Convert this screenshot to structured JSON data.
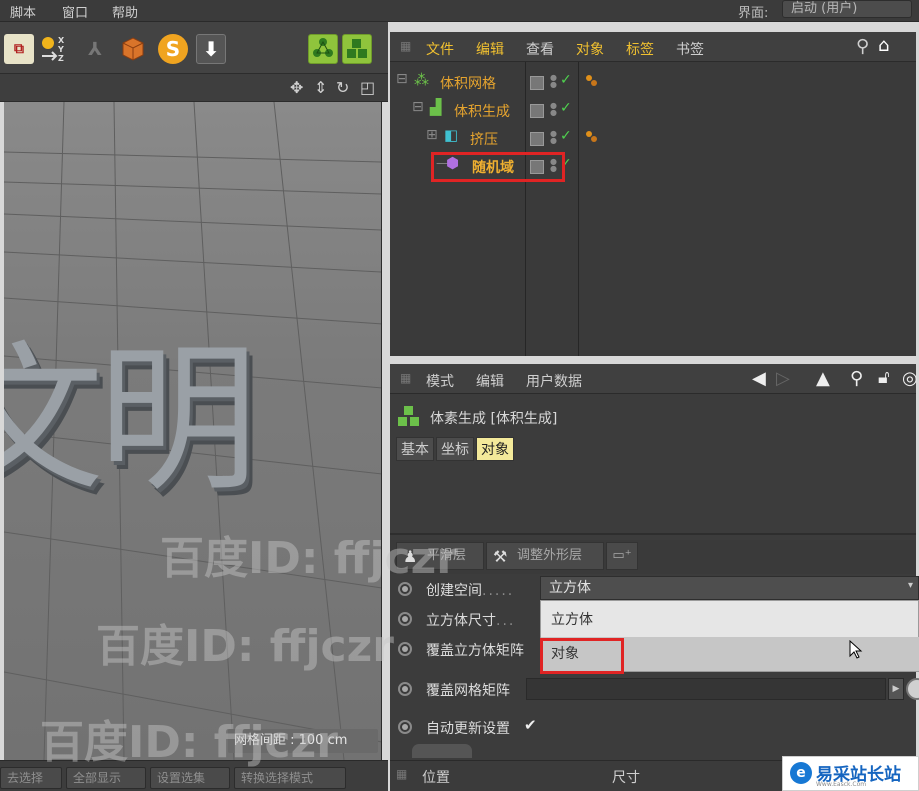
{
  "menubar": {
    "items": [
      "脚本",
      "窗口",
      "帮助"
    ],
    "layout_label": "界面:",
    "layout_value": "启动 (用户)"
  },
  "toolbar": {
    "icons": [
      "xref-icon",
      "coordinate-system-icon",
      "joint-icon",
      "object-axis-icon",
      "snap-s-icon",
      "download-icon",
      "volume-mesher-icon",
      "volume-builder-icon"
    ],
    "snap_label": "S",
    "axis_label": "X Y Z"
  },
  "object_manager": {
    "menu": [
      "文件",
      "编辑",
      "查看",
      "对象",
      "标签",
      "书签"
    ],
    "objects": [
      {
        "name": "体积网格",
        "depth": 0
      },
      {
        "name": "体积生成",
        "depth": 1
      },
      {
        "name": "挤压",
        "depth": 2
      },
      {
        "name": "随机域",
        "depth": 3
      }
    ]
  },
  "attribute_manager": {
    "menu": [
      "模式",
      "编辑",
      "用户数据"
    ],
    "title": "体素生成 [体积生成]",
    "tabs": [
      "基本",
      "坐标",
      "对象"
    ],
    "active_tab": "对象",
    "layer_buttons": [
      "平滑层",
      "调整外形层"
    ],
    "properties": [
      {
        "label": "创建空间",
        "dots": "....."
      },
      {
        "label": "立方体尺寸",
        "dots": "..."
      },
      {
        "label": "覆盖立方体矩阵",
        "dots": ""
      },
      {
        "label": "覆盖网格矩阵",
        "dots": ""
      },
      {
        "label": "自动更新设置",
        "dots": ""
      }
    ],
    "space_value": "立方体",
    "dropdown_options": [
      "立方体",
      "对象"
    ],
    "auto_update_check": "✔"
  },
  "viewport": {
    "text": "文明",
    "grid_spacing": "网格间距 : 100 cm"
  },
  "bottom_left_buttons": [
    "去选择",
    "全部显示",
    "设置选集",
    "转换选择模式"
  ],
  "coordinates": {
    "position": "位置",
    "size": "尺寸"
  },
  "watermark": {
    "text": "百度ID: ffjczr"
  },
  "brand": {
    "name": "易采站长站",
    "url": "Www.Easck.Com"
  },
  "colors": {
    "accent_orange": "#e6a42e",
    "highlight_red": "#e02424",
    "active_tab": "#f3e99a",
    "check_green": "#4fd24f"
  }
}
